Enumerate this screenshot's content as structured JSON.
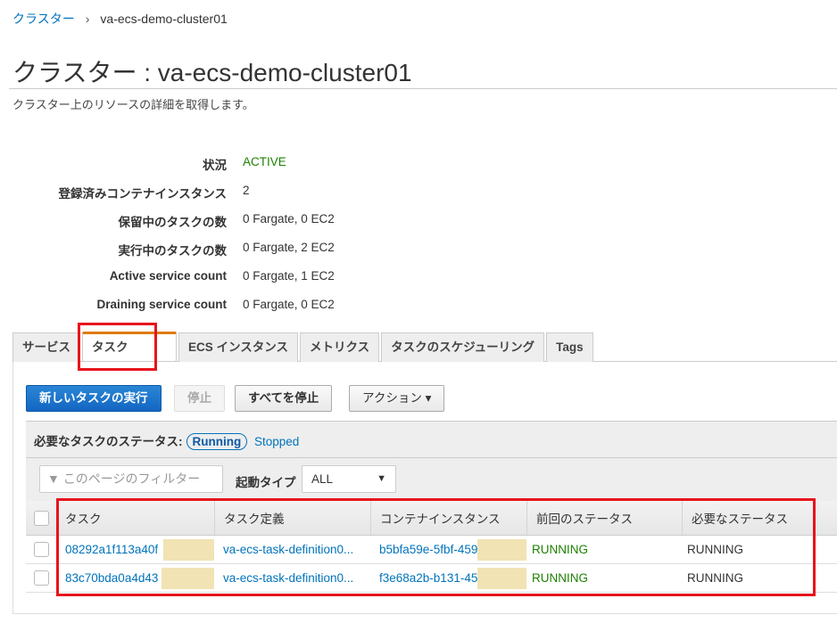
{
  "breadcrumb": {
    "root": "クラスター",
    "current": "va-ecs-demo-cluster01"
  },
  "title": "クラスター : va-ecs-demo-cluster01",
  "subtitle": "クラスター上のリソースの詳細を取得します。",
  "details": [
    {
      "label": "状況",
      "value": "ACTIVE"
    },
    {
      "label": "登録済みコンテナインスタンス",
      "value": "2"
    },
    {
      "label": "保留中のタスクの数",
      "value": "0 Fargate, 0 EC2"
    },
    {
      "label": "実行中のタスクの数",
      "value": "0 Fargate, 2 EC2"
    },
    {
      "label": "Active service count",
      "value": "0 Fargate, 1 EC2"
    },
    {
      "label": "Draining service count",
      "value": "0 Fargate, 0 EC2"
    }
  ],
  "tabs": [
    "サービス",
    "タスク",
    "ECS インスタンス",
    "メトリクス",
    "タスクのスケジューリング",
    "Tags"
  ],
  "buttons": {
    "run": "新しいタスクの実行",
    "stop": "停止",
    "stop_all": "すべてを停止",
    "actions": "アクション ▾"
  },
  "status_filter": {
    "label": "必要なタスクのステータス:",
    "running": "Running",
    "stopped": "Stopped"
  },
  "filter": {
    "placeholder": "このページのフィルター",
    "launch_label": "起動タイプ",
    "launch_value": "ALL"
  },
  "table": {
    "headers": [
      "タスク",
      "タスク定義",
      "コンテナインスタンス",
      "前回のステータス",
      "必要なステータス"
    ],
    "rows": [
      [
        "08292a1f113a40f",
        "va-ecs-task-definition0...",
        "b5bfa59e-5fbf-459",
        "RUNNING",
        "RUNNING"
      ],
      [
        "83c70bda0a4d43",
        "va-ecs-task-definition0...",
        "f3e68a2b-b131-45",
        "RUNNING",
        "RUNNING"
      ]
    ]
  }
}
